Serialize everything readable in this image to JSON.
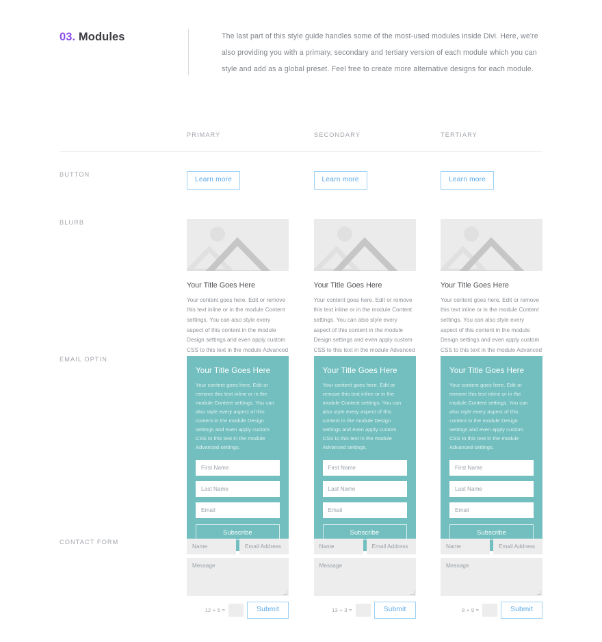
{
  "intro": {
    "number": "03.",
    "title": " Modules",
    "description": "The last part of this style guide handles some of the most-used modules inside Divi. Here, we're also providing you with a primary, secondary and tertiary version of each module which you can style and add as a global preset. Feel free to create more alternative designs for each module."
  },
  "columns": [
    {
      "label": "PRIMARY"
    },
    {
      "label": "SECONDARY"
    },
    {
      "label": "TERTIARY"
    }
  ],
  "rows": {
    "button": {
      "label": "BUTTON",
      "items": [
        {
          "text": "Learn more"
        },
        {
          "text": "Learn more"
        },
        {
          "text": "Learn more"
        }
      ]
    },
    "blurb": {
      "label": "BLURB",
      "items": [
        {
          "image_alt": "placeholder-mountains-image",
          "title": "Your Title Goes Here",
          "body": "Your content goes here. Edit or remove this text inline or in the module Content settings. You can also style every aspect of this content in the module Design settings and even apply custom CSS to this text in the module Advanced settings."
        },
        {
          "image_alt": "placeholder-mountains-image",
          "title": "Your Title Goes Here",
          "body": "Your content goes here. Edit or remove this text inline or in the module Content settings. You can also style every aspect of this content in the module Design settings and even apply custom CSS to this text in the module Advanced settings."
        },
        {
          "image_alt": "placeholder-mountains-image",
          "title": "Your Title Goes Here",
          "body": "Your content goes here. Edit or remove this text inline or in the module Content settings. You can also style every aspect of this content in the module Design settings and even apply custom CSS to this text in the module Advanced settings."
        }
      ]
    },
    "optin": {
      "label": "EMAIL OPTIN",
      "items": [
        {
          "title": "Your Title Goes Here",
          "body": "Your content goes here. Edit or remove this text inline or in the module Content settings. You can also style every aspect of this content in the module Design settings and even apply custom CSS to this text in the module Advanced settings.",
          "first_name_placeholder": "First Name",
          "last_name_placeholder": "Last Name",
          "email_placeholder": "Email",
          "submit_label": "Subscribe"
        },
        {
          "title": "Your Title Goes Here",
          "body": "Your content goes here. Edit or remove this text inline or in the module Content settings. You can also style every aspect of this content in the module Design settings and even apply custom CSS to this text in the module Advanced settings.",
          "first_name_placeholder": "First Name",
          "last_name_placeholder": "Last Name",
          "email_placeholder": "Email",
          "submit_label": "Subscribe"
        },
        {
          "title": "Your Title Goes Here",
          "body": "Your content goes here. Edit or remove this text inline or in the module Content settings. You can also style every aspect of this content in the module Design settings and even apply custom CSS to this text in the module Advanced settings.",
          "first_name_placeholder": "First Name",
          "last_name_placeholder": "Last Name",
          "email_placeholder": "Email",
          "submit_label": "Subscribe"
        }
      ]
    },
    "contact": {
      "label": "CONTACT FORM",
      "items": [
        {
          "name_placeholder": "Name",
          "email_placeholder": "Email Address",
          "message_placeholder": "Message",
          "captcha": "12 + 5 =",
          "submit_label": "Submit"
        },
        {
          "name_placeholder": "Name",
          "email_placeholder": "Email Address",
          "message_placeholder": "Message",
          "captcha": "13 + 3 =",
          "submit_label": "Submit"
        },
        {
          "name_placeholder": "Name",
          "email_placeholder": "Email Address",
          "message_placeholder": "Message",
          "captcha": "8 + 9 =",
          "submit_label": "Submit"
        }
      ]
    }
  },
  "colors": {
    "accent_purple": "#8a4fe8",
    "button_blue": "#5ba9e8",
    "button_border": "#9ad0f5",
    "optin_teal": "#73bfbf",
    "label_gray": "#a2a6ac",
    "body_gray": "#8c9096",
    "placeholder_bg": "#ebebeb",
    "field_gray": "#ededed"
  }
}
